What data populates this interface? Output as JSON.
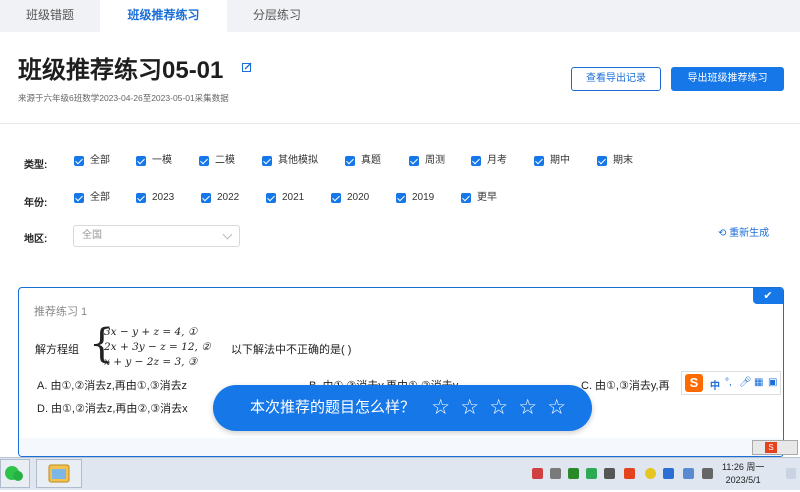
{
  "tabs": [
    {
      "label": "班级错题",
      "active": false
    },
    {
      "label": "班级推荐练习",
      "active": true
    },
    {
      "label": "分层练习",
      "active": false
    }
  ],
  "header": {
    "title": "班级推荐练习05-01",
    "subtitle": "来源于六年级6班数学2023-04-26至2023-05-01采集数据",
    "btn_view_records": "查看导出记录",
    "btn_export": "导出班级推荐练习"
  },
  "filters": {
    "type_label": "类型:",
    "type_options": [
      "全部",
      "一模",
      "二模",
      "其他模拟",
      "真题",
      "周测",
      "月考",
      "期中",
      "期末"
    ],
    "year_label": "年份:",
    "year_options": [
      "全部",
      "2023",
      "2022",
      "2021",
      "2020",
      "2019",
      "更早"
    ],
    "region_label": "地区:",
    "region_value": "全国",
    "regenerate": "重新生成"
  },
  "card": {
    "title": "推荐练习 1",
    "question_prefix": "解方程组",
    "equations": [
      "3x − y + z = 4, ①",
      "2x + 3y − z = 12, ②",
      "x + y − 2z = 3, ③"
    ],
    "question_suffix": "以下解法中不正确的是(    )",
    "options": {
      "a": "A. 由①,②消去z,再由①,③消去z",
      "b": "B. 由①,③消去y,再由①,②消去y",
      "c": "C. 由①,③消去y,再",
      "d": "D. 由①,②消去z,再由②,③消去x"
    }
  },
  "rating": {
    "prompt": "本次推荐的题目怎么样？",
    "stars_total": 5,
    "stars_selected": 0
  },
  "ime": {
    "lang": "中",
    "logo": "S"
  },
  "taskbar": {
    "time": "11:26 周一",
    "date": "2023/5/1"
  },
  "colors": {
    "accent": "#1677e8",
    "ime_orange": "#ff6a00"
  }
}
